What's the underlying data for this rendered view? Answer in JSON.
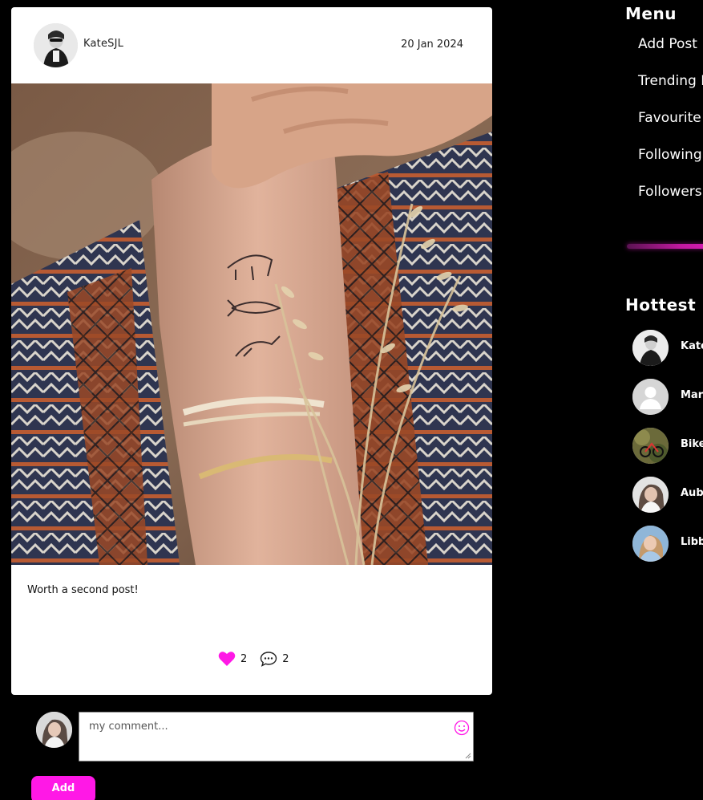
{
  "post": {
    "author": "KateSJL",
    "date": "20 Jan 2024",
    "text": "Worth a second post!",
    "likes": "2",
    "comments": "2"
  },
  "comment_form": {
    "placeholder": "my comment...",
    "add_label": "Add"
  },
  "menu": {
    "title": "Menu",
    "items": [
      {
        "label": "Add Post",
        "icon": "plus-circle-icon"
      },
      {
        "label": "Trending P"
      },
      {
        "label": "Favourite"
      },
      {
        "label": "Following"
      },
      {
        "label": "Followers"
      }
    ]
  },
  "hottest": {
    "title": "Hottest F",
    "profiles": [
      {
        "name": "Kate"
      },
      {
        "name": "Mars"
      },
      {
        "name": "Bike"
      },
      {
        "name": "Aubr"
      },
      {
        "name": "Libb"
      }
    ]
  },
  "colors": {
    "accent": "#ff18e6",
    "background": "#000000",
    "card": "#ffffff"
  }
}
